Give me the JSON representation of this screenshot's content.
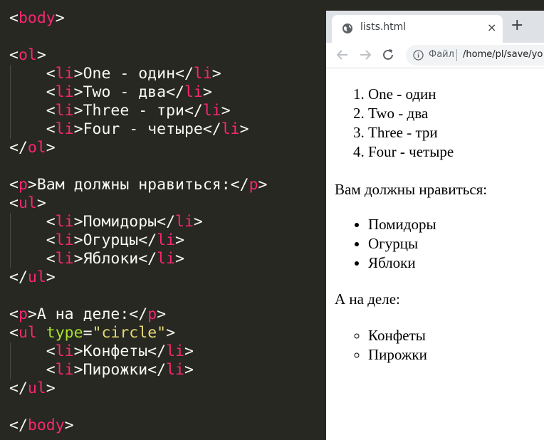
{
  "editor": {
    "lines": [
      {
        "parts": [
          {
            "t": "<",
            "c": ""
          },
          {
            "t": "body",
            "c": "tag"
          },
          {
            "t": ">",
            "c": ""
          }
        ]
      },
      {
        "parts": []
      },
      {
        "parts": [
          {
            "t": "<",
            "c": ""
          },
          {
            "t": "ol",
            "c": "tag"
          },
          {
            "t": ">",
            "c": ""
          }
        ]
      },
      {
        "parts": [
          {
            "t": "    <",
            "c": ""
          },
          {
            "t": "li",
            "c": "tag"
          },
          {
            "t": ">One - один</",
            "c": ""
          },
          {
            "t": "li",
            "c": "tag"
          },
          {
            "t": ">",
            "c": ""
          }
        ]
      },
      {
        "parts": [
          {
            "t": "    <",
            "c": ""
          },
          {
            "t": "li",
            "c": "tag"
          },
          {
            "t": ">Two - два</",
            "c": ""
          },
          {
            "t": "li",
            "c": "tag"
          },
          {
            "t": ">",
            "c": ""
          }
        ]
      },
      {
        "parts": [
          {
            "t": "    <",
            "c": ""
          },
          {
            "t": "li",
            "c": "tag"
          },
          {
            "t": ">Three - три</",
            "c": ""
          },
          {
            "t": "li",
            "c": "tag"
          },
          {
            "t": ">",
            "c": ""
          }
        ]
      },
      {
        "parts": [
          {
            "t": "    <",
            "c": ""
          },
          {
            "t": "li",
            "c": "tag"
          },
          {
            "t": ">Four - четыре</",
            "c": ""
          },
          {
            "t": "li",
            "c": "tag"
          },
          {
            "t": ">",
            "c": ""
          }
        ]
      },
      {
        "parts": [
          {
            "t": "</",
            "c": ""
          },
          {
            "t": "ol",
            "c": "tag"
          },
          {
            "t": ">",
            "c": ""
          }
        ]
      },
      {
        "parts": []
      },
      {
        "parts": [
          {
            "t": "<",
            "c": ""
          },
          {
            "t": "p",
            "c": "tag"
          },
          {
            "t": ">Вам должны нравиться:</",
            "c": ""
          },
          {
            "t": "p",
            "c": "tag"
          },
          {
            "t": ">",
            "c": ""
          }
        ]
      },
      {
        "parts": [
          {
            "t": "<",
            "c": ""
          },
          {
            "t": "ul",
            "c": "tag"
          },
          {
            "t": ">",
            "c": ""
          }
        ]
      },
      {
        "parts": [
          {
            "t": "    <",
            "c": ""
          },
          {
            "t": "li",
            "c": "tag"
          },
          {
            "t": ">Помидоры</",
            "c": ""
          },
          {
            "t": "li",
            "c": "tag"
          },
          {
            "t": ">",
            "c": ""
          }
        ]
      },
      {
        "parts": [
          {
            "t": "    <",
            "c": ""
          },
          {
            "t": "li",
            "c": "tag"
          },
          {
            "t": ">Огурцы</",
            "c": ""
          },
          {
            "t": "li",
            "c": "tag"
          },
          {
            "t": ">",
            "c": ""
          }
        ]
      },
      {
        "parts": [
          {
            "t": "    <",
            "c": ""
          },
          {
            "t": "li",
            "c": "tag"
          },
          {
            "t": ">Яблоки</",
            "c": ""
          },
          {
            "t": "li",
            "c": "tag"
          },
          {
            "t": ">",
            "c": ""
          }
        ]
      },
      {
        "parts": [
          {
            "t": "</",
            "c": ""
          },
          {
            "t": "ul",
            "c": "tag"
          },
          {
            "t": ">",
            "c": ""
          }
        ]
      },
      {
        "parts": []
      },
      {
        "parts": [
          {
            "t": "<",
            "c": ""
          },
          {
            "t": "p",
            "c": "tag"
          },
          {
            "t": ">А на деле:</",
            "c": ""
          },
          {
            "t": "p",
            "c": "tag"
          },
          {
            "t": ">",
            "c": ""
          }
        ]
      },
      {
        "parts": [
          {
            "t": "<",
            "c": ""
          },
          {
            "t": "ul",
            "c": "tag"
          },
          {
            "t": " ",
            "c": ""
          },
          {
            "t": "type",
            "c": "attr"
          },
          {
            "t": "=",
            "c": ""
          },
          {
            "t": "\"circle\"",
            "c": "str"
          },
          {
            "t": ">",
            "c": ""
          }
        ]
      },
      {
        "parts": [
          {
            "t": "    <",
            "c": ""
          },
          {
            "t": "li",
            "c": "tag"
          },
          {
            "t": ">Конфеты</",
            "c": ""
          },
          {
            "t": "li",
            "c": "tag"
          },
          {
            "t": ">",
            "c": ""
          }
        ]
      },
      {
        "parts": [
          {
            "t": "    <",
            "c": ""
          },
          {
            "t": "li",
            "c": "tag"
          },
          {
            "t": ">Пирожки</",
            "c": ""
          },
          {
            "t": "li",
            "c": "tag"
          },
          {
            "t": ">",
            "c": ""
          }
        ]
      },
      {
        "parts": [
          {
            "t": "</",
            "c": ""
          },
          {
            "t": "ul",
            "c": "tag"
          },
          {
            "t": ">",
            "c": ""
          }
        ]
      },
      {
        "parts": []
      },
      {
        "parts": [
          {
            "t": "</",
            "c": ""
          },
          {
            "t": "body",
            "c": "tag"
          },
          {
            "t": ">",
            "c": ""
          }
        ]
      }
    ]
  },
  "browser": {
    "tab_title": "lists.html",
    "tab_close": "×",
    "new_tab": "+",
    "origin_label": "Файл",
    "url": "/home/pl/save/yo",
    "content": {
      "ordered_list": [
        "One - один",
        "Two - два",
        "Three - три",
        "Four - четыре"
      ],
      "paragraph_1": "Вам должны нравиться:",
      "list_disc": [
        "Помидоры",
        "Огурцы",
        "Яблоки"
      ],
      "paragraph_2": "А на деле:",
      "list_circle": [
        "Конфеты",
        "Пирожки"
      ]
    }
  },
  "colors": {
    "editor_bg": "#272822",
    "tag": "#f92672",
    "attr": "#a6e22e",
    "string": "#e6db74",
    "text": "#f8f8f2"
  }
}
